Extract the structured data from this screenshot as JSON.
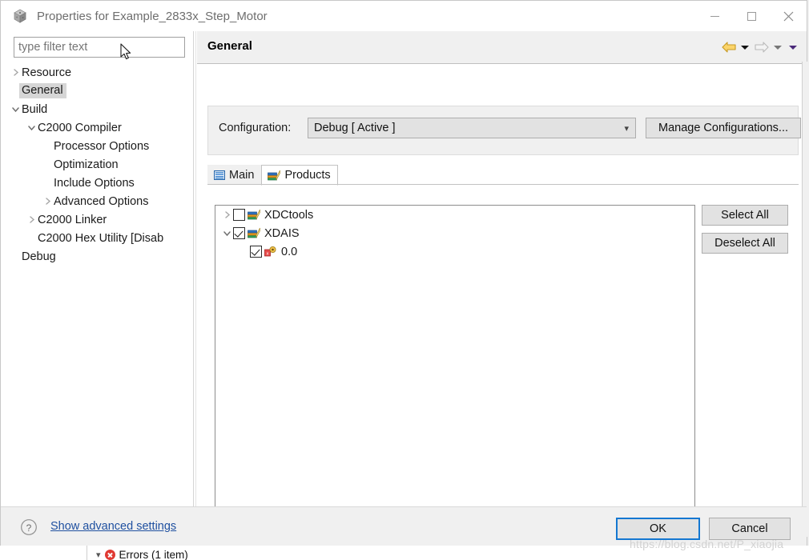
{
  "window": {
    "title": "Properties for Example_2833x_Step_Motor",
    "app_icon": "cube-icon",
    "controls": {
      "minimize": "minimize-icon",
      "maximize": "maximize-icon",
      "close": "close-icon"
    }
  },
  "sidebar": {
    "filter": {
      "value": "",
      "placeholder": "type filter text"
    },
    "tree": [
      {
        "label": "Resource",
        "indent": 0,
        "twisty": "collapsed",
        "selected": false
      },
      {
        "label": "General",
        "indent": 0,
        "twisty": "none",
        "selected": true
      },
      {
        "label": "Build",
        "indent": 0,
        "twisty": "expanded",
        "selected": false
      },
      {
        "label": "C2000 Compiler",
        "indent": 1,
        "twisty": "expanded",
        "selected": false
      },
      {
        "label": "Processor Options",
        "indent": 2,
        "twisty": "none",
        "selected": false
      },
      {
        "label": "Optimization",
        "indent": 2,
        "twisty": "none",
        "selected": false
      },
      {
        "label": "Include Options",
        "indent": 2,
        "twisty": "none",
        "selected": false
      },
      {
        "label": "Advanced Options",
        "indent": 2,
        "twisty": "collapsed",
        "selected": false
      },
      {
        "label": "C2000 Linker",
        "indent": 1,
        "twisty": "collapsed",
        "selected": false
      },
      {
        "label": "C2000 Hex Utility  [Disab",
        "indent": 1,
        "twisty": "none",
        "selected": false
      },
      {
        "label": "Debug",
        "indent": 0,
        "twisty": "none",
        "selected": false
      }
    ],
    "scrollbar": {
      "left_arrow": "chevron-left-icon",
      "right_arrow": "chevron-right-icon"
    }
  },
  "page": {
    "title": "General",
    "nav": {
      "back": "back-arrow-icon",
      "back_menu": "chevron-down-icon",
      "forward": "forward-arrow-icon",
      "forward_menu": "chevron-down-icon",
      "extra_menu": "chevron-down-icon"
    },
    "configuration": {
      "label": "Configuration:",
      "selected": "Debug  [ Active ]",
      "options": [
        "Debug  [ Active ]"
      ],
      "dropdown_icon": "chevron-down-icon",
      "manage_button": "Manage Configurations..."
    },
    "tabs": [
      {
        "label": "Main",
        "icon": "main-list-icon",
        "active": false
      },
      {
        "label": "Products",
        "icon": "books-icon",
        "active": true
      }
    ],
    "products": [
      {
        "label": "XDCtools",
        "indent": 0,
        "twisty": "collapsed",
        "checked": false,
        "icon": "books-icon"
      },
      {
        "label": "XDAIS",
        "indent": 0,
        "twisty": "expanded",
        "checked": true,
        "icon": "books-icon"
      },
      {
        "label": "0.0",
        "indent": 1,
        "twisty": "none",
        "checked": true,
        "icon": "version-gear-icon"
      }
    ],
    "side_buttons": [
      {
        "label": "Select All"
      },
      {
        "label": "Deselect All"
      }
    ]
  },
  "footer": {
    "help_icon": "help-icon",
    "advanced_link": "Show advanced settings",
    "ok_label": "OK",
    "cancel_label": "Cancel"
  },
  "background": {
    "errors_row": "Errors (1 item)",
    "errors_icon": "error-icon",
    "errors_twisty": "chevron-down-icon"
  },
  "watermark": "https://blog.csdn.net/P_xiaojia",
  "colors": {
    "accent": "#1477d1",
    "link": "#1f50a0",
    "error": "#e03a33",
    "panel": "#f0f0f0"
  }
}
